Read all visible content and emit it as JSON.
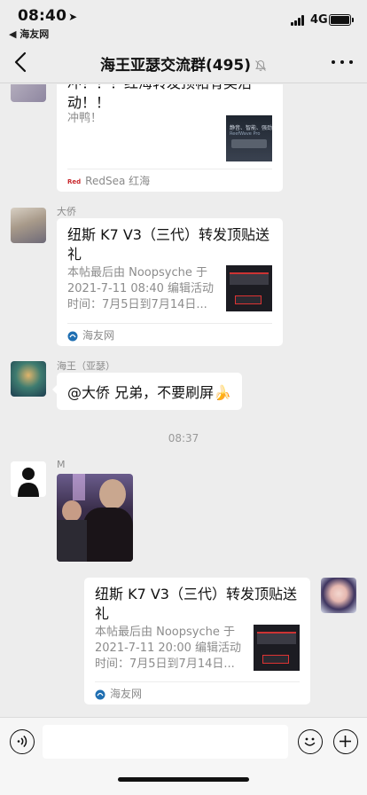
{
  "status_bar": {
    "time": "08:40",
    "back_app": "◀ 海友网",
    "network": "4G"
  },
  "nav": {
    "title": "海王亚瑟交流群(495)"
  },
  "messages": {
    "card1": {
      "title_partial": "冲！！！红海转发顶帖有奖活动！！",
      "desc": "冲鸭！",
      "source": "RedSea 红海",
      "thumb_text_line1": "静音、智能、强劲",
      "thumb_text_line2": "ReefWave Pro"
    },
    "card2": {
      "sender": "大侨",
      "title": "纽斯 K7 V3（三代）转发顶贴送礼",
      "desc_line1": "本帖最后由 Noopsyche 于",
      "desc_line2": "2021-7-11 08:40 编辑活动",
      "desc_line3": "时间：7月5日到7月14日...",
      "source": "海友网"
    },
    "text1": {
      "sender": "海王（亚瑟）",
      "text": "@大侨 兄弟，不要刷屏🍌"
    },
    "timestamp": "08:37",
    "photo_msg": {
      "sender": "M"
    },
    "card3": {
      "title": "纽斯 K7 V3（三代）转发顶贴送礼",
      "desc_line1": "本帖最后由 Noopsyche 于",
      "desc_line2": "2021-7-11 20:00 编辑活动",
      "desc_line3": "时间：7月5日到7月14日...",
      "source": "海友网"
    }
  },
  "input": {
    "placeholder": "",
    "value": ""
  },
  "colors": {
    "background": "#ededed",
    "bubble": "#ffffff",
    "meta_text": "#8a8a8a"
  }
}
